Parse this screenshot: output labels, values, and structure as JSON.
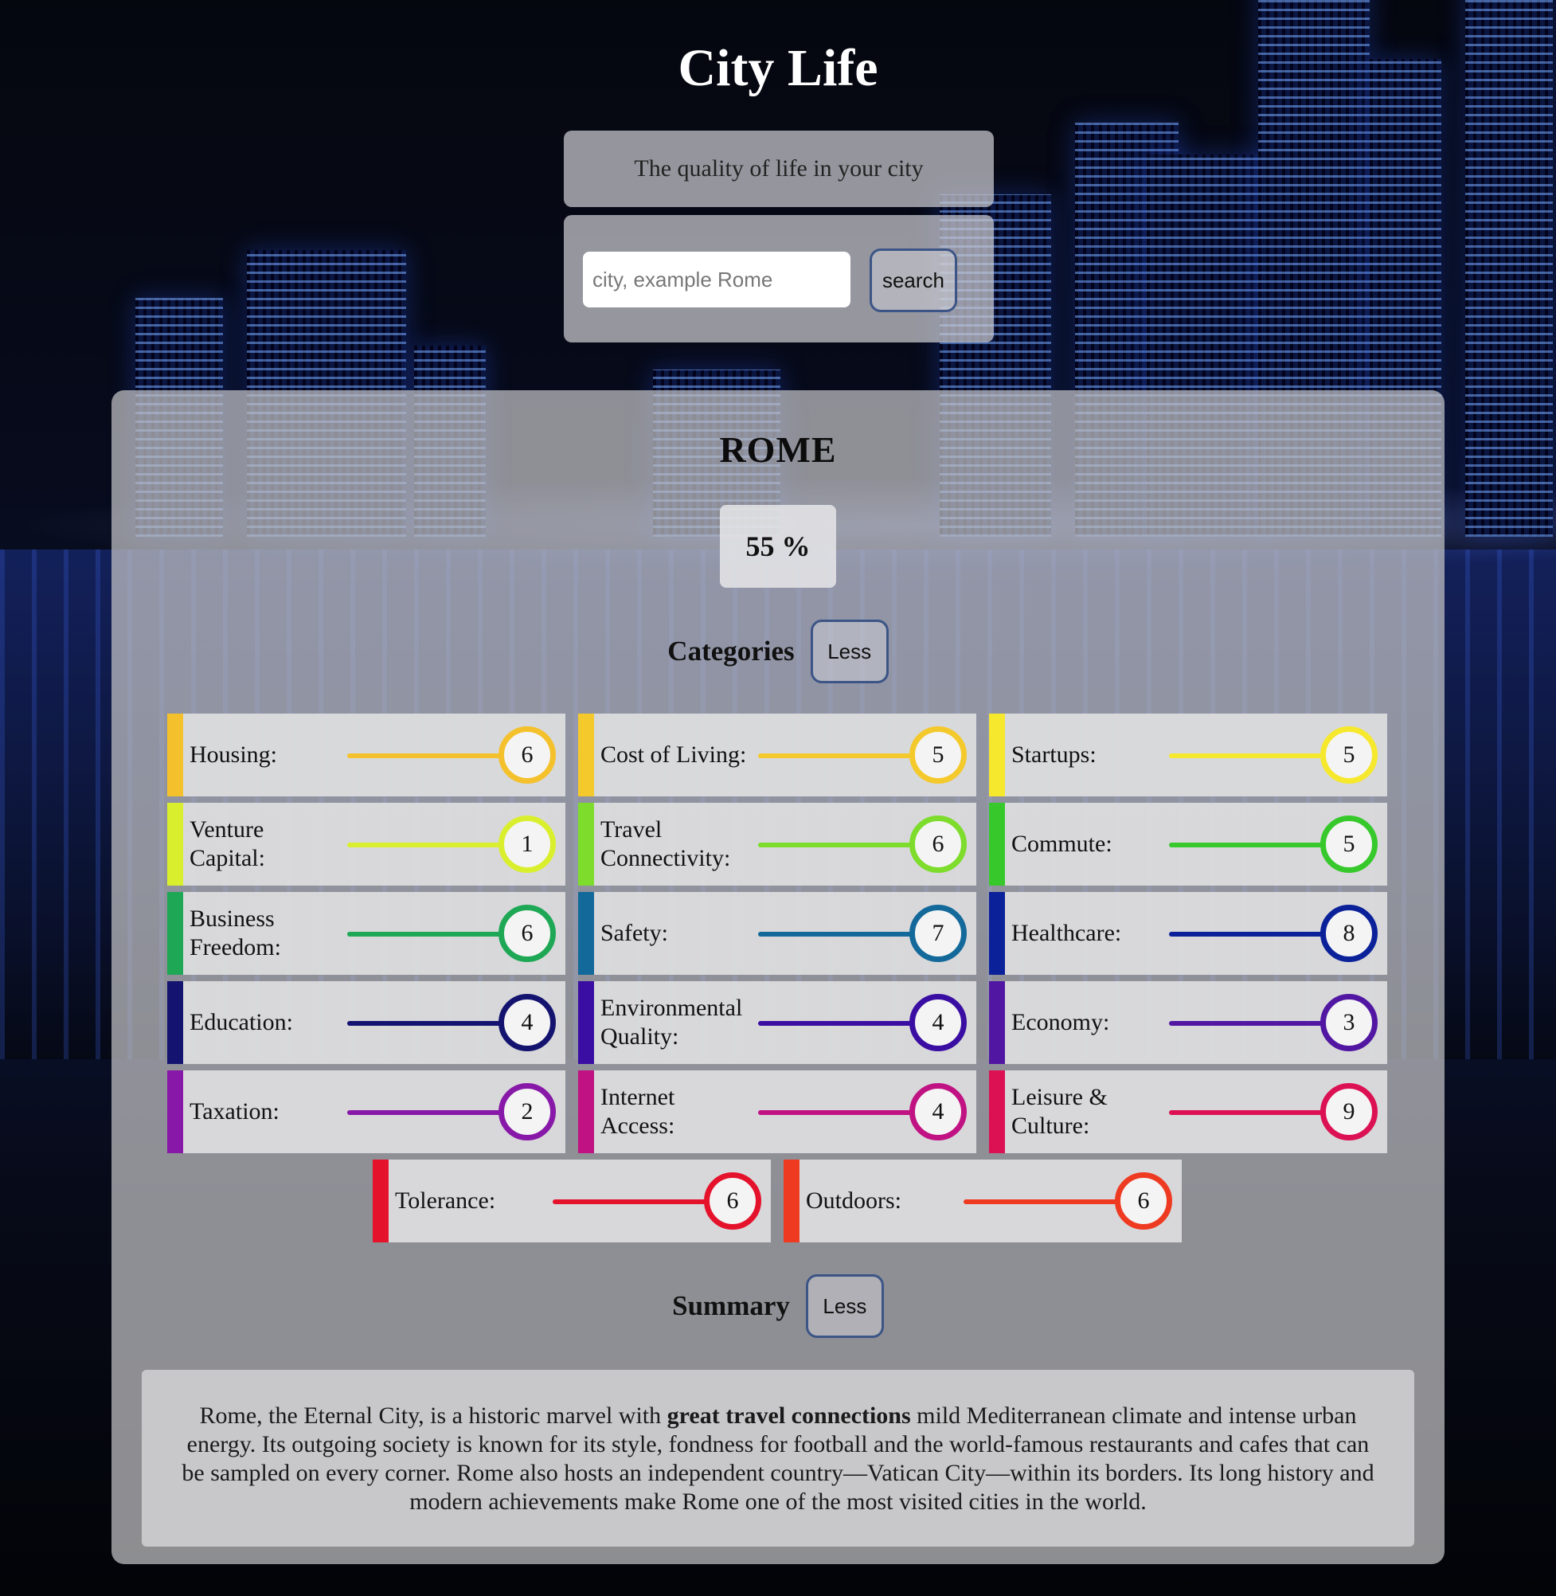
{
  "app": {
    "title": "City Life",
    "tagline": "The quality of life in your city"
  },
  "search": {
    "placeholder": "city, example Rome",
    "value": "",
    "button_label": "search"
  },
  "result": {
    "city": "ROME",
    "score": "55 %"
  },
  "categories_section": {
    "heading": "Categories",
    "toggle_label": "Less"
  },
  "categories": [
    {
      "name": "Housing:",
      "score": "6",
      "color": "#f4c12c"
    },
    {
      "name": "Cost of Living:",
      "score": "5",
      "color": "#f4c92c"
    },
    {
      "name": "Startups:",
      "score": "5",
      "color": "#f6e82c"
    },
    {
      "name": "Venture Capital:",
      "score": "1",
      "color": "#d9ef2e"
    },
    {
      "name": "Travel Connectivity:",
      "score": "6",
      "color": "#7ddc2c"
    },
    {
      "name": "Commute:",
      "score": "5",
      "color": "#37c92c"
    },
    {
      "name": "Business Freedom:",
      "score": "6",
      "color": "#1ea855"
    },
    {
      "name": "Safety:",
      "score": "7",
      "color": "#13699a"
    },
    {
      "name": "Healthcare:",
      "score": "8",
      "color": "#0a2199"
    },
    {
      "name": "Education:",
      "score": "4",
      "color": "#141470"
    },
    {
      "name": "Environmental Quality:",
      "score": "4",
      "color": "#3a0ea2"
    },
    {
      "name": "Economy:",
      "score": "3",
      "color": "#5117a3"
    },
    {
      "name": "Taxation:",
      "score": "2",
      "color": "#8819a8"
    },
    {
      "name": "Internet Access:",
      "score": "4",
      "color": "#c01282"
    },
    {
      "name": "Leisure & Culture:",
      "score": "9",
      "color": "#dc1154"
    },
    {
      "name": "Tolerance:",
      "score": "6",
      "color": "#e4122b"
    },
    {
      "name": "Outdoors:",
      "score": "6",
      "color": "#ef3a22"
    }
  ],
  "summary_section": {
    "heading": "Summary",
    "toggle_label": "Less",
    "text_before": "Rome, the Eternal City, is a historic marvel with ",
    "text_bold": "great travel connections",
    "text_after": " mild Mediterranean climate and intense urban energy. Its outgoing society is known for its style, fondness for football and the world-famous restaurants and cafes that can be sampled on every corner. Rome also hosts an independent country—Vatican City—within its borders. Its long history and modern achievements make Rome one of the most visited cities in the world."
  }
}
